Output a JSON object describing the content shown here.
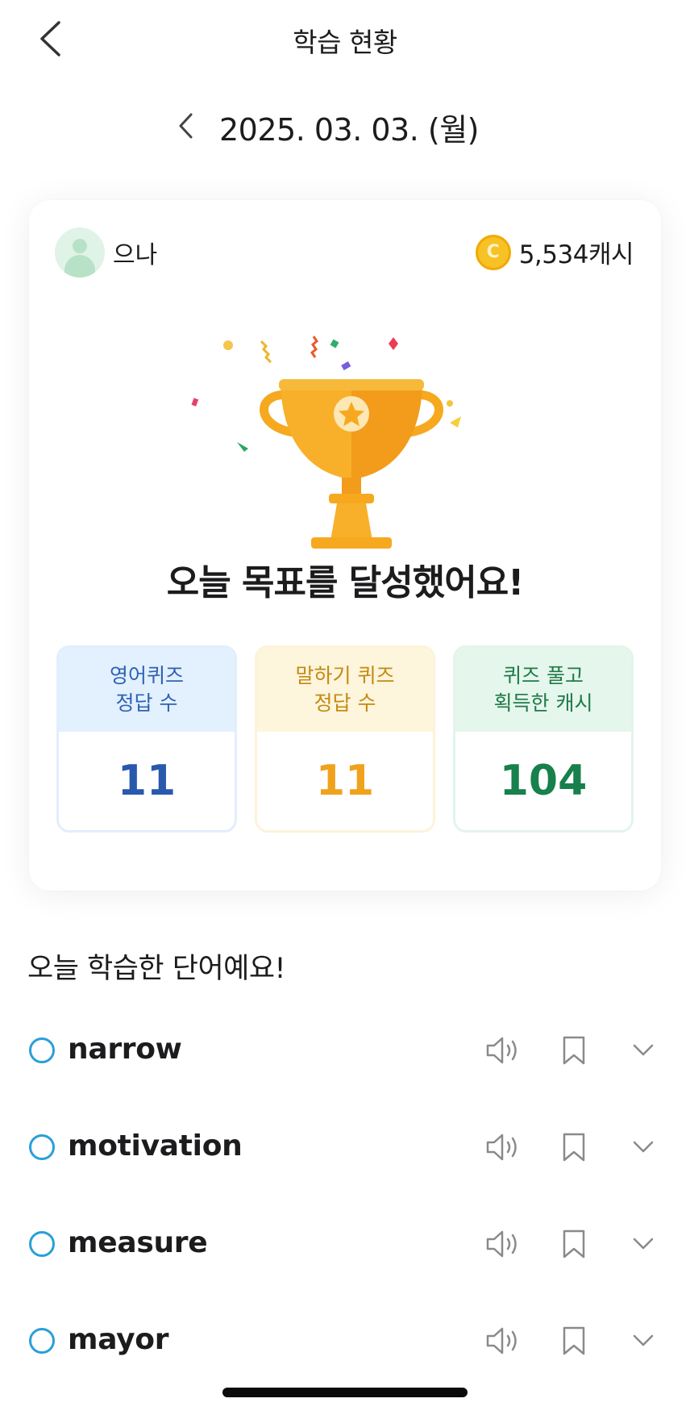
{
  "header": {
    "title": "학습 현황"
  },
  "date_nav": {
    "date": "2025. 03. 03. (월)"
  },
  "summary_card": {
    "user_name": "으나",
    "cash_amount": "5,534캐시",
    "goal_message": "오늘 목표를 달성했어요!",
    "stats": [
      {
        "label": "영어퀴즈\n정답 수",
        "value": "11"
      },
      {
        "label": "말하기 퀴즈\n정답 수",
        "value": "11"
      },
      {
        "label": "퀴즈 풀고\n획득한 캐시",
        "value": "104"
      }
    ]
  },
  "words_section": {
    "title": "오늘 학습한 단어예요!",
    "words": [
      {
        "word": "narrow"
      },
      {
        "word": "motivation"
      },
      {
        "word": "measure"
      },
      {
        "word": "mayor"
      }
    ]
  },
  "colors": {
    "english_accent": "#2859ad",
    "speaking_accent": "#f0a21c",
    "cash_accent": "#17804c",
    "check_circle": "#2a9fd8",
    "trophy": "#f6a91e"
  },
  "icons": [
    "chevron-left-icon",
    "coin-icon",
    "trophy-icon",
    "speaker-icon",
    "bookmark-icon",
    "chevron-down-icon"
  ]
}
